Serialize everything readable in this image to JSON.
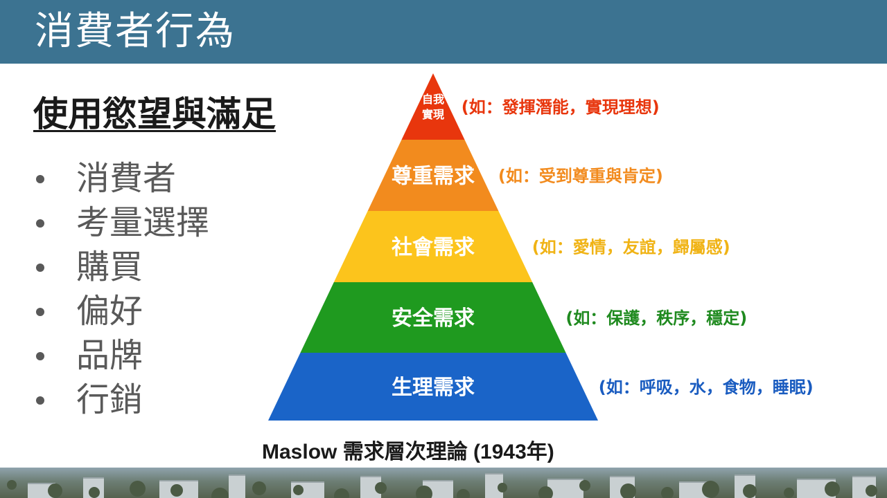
{
  "header": {
    "title": "消費者行為"
  },
  "subtitle": "使用慾望與滿足",
  "bullets": [
    "消費者",
    "考量選擇",
    "購買",
    "偏好",
    "品牌",
    "行銷"
  ],
  "pyramid": {
    "levels": [
      {
        "name_lines": [
          "自我",
          "實現"
        ],
        "note": "(如：發揮潛能，實現理想)",
        "fill": "#e8360d",
        "note_color": "#e8360d"
      },
      {
        "name_lines": [
          "尊重需求"
        ],
        "note": "(如：受到尊重與肯定)",
        "fill": "#f28b1e",
        "note_color": "#f28b1e"
      },
      {
        "name_lines": [
          "社會需求"
        ],
        "note": "(如：愛情，友誼，歸屬感)",
        "fill": "#fcc41c",
        "note_color": "#f0b315"
      },
      {
        "name_lines": [
          "安全需求"
        ],
        "note": "(如：保護，秩序，穩定)",
        "fill": "#1f9a1f",
        "note_color": "#1f8a1f"
      },
      {
        "name_lines": [
          "生理需求"
        ],
        "note": "(如：呼吸，水，食物，睡眠)",
        "fill": "#1a64c8",
        "note_color": "#1a5cc0"
      }
    ],
    "caption": "Maslow 需求層次理論 (1943年)"
  }
}
